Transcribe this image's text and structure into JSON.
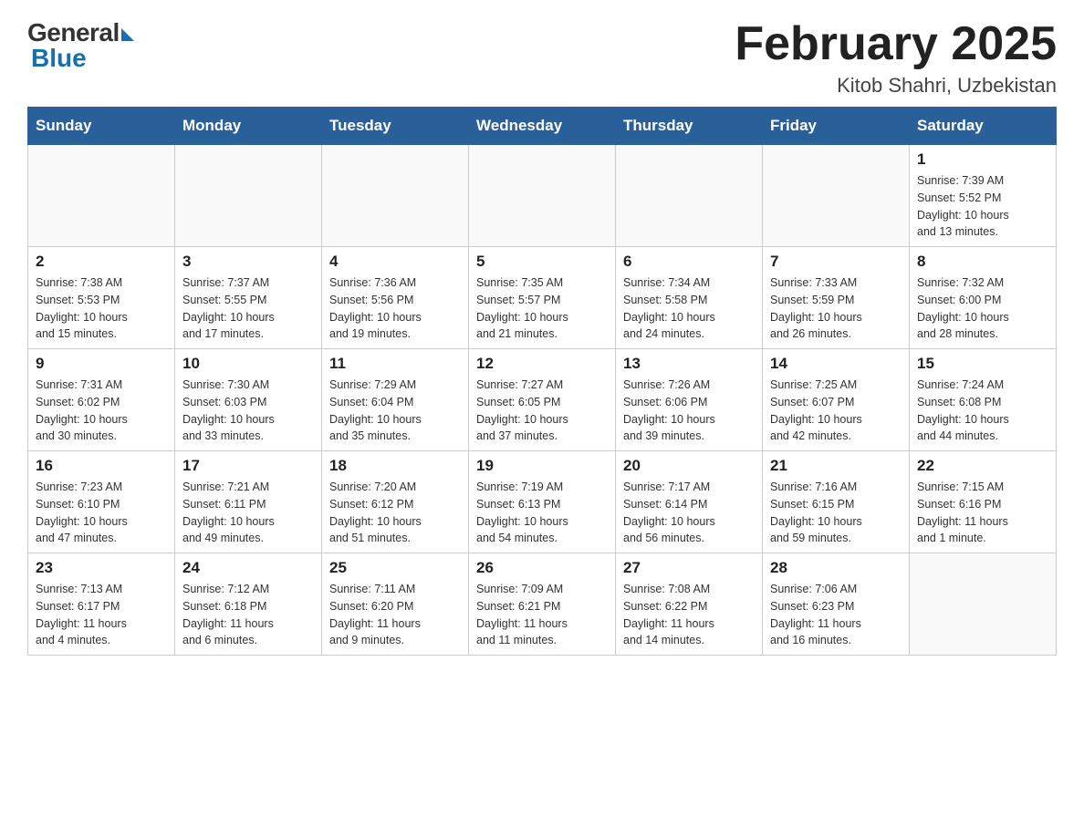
{
  "header": {
    "title": "February 2025",
    "location": "Kitob Shahri, Uzbekistan"
  },
  "logo": {
    "general": "General",
    "blue": "Blue"
  },
  "weekdays": [
    "Sunday",
    "Monday",
    "Tuesday",
    "Wednesday",
    "Thursday",
    "Friday",
    "Saturday"
  ],
  "weeks": [
    [
      {
        "day": "",
        "info": ""
      },
      {
        "day": "",
        "info": ""
      },
      {
        "day": "",
        "info": ""
      },
      {
        "day": "",
        "info": ""
      },
      {
        "day": "",
        "info": ""
      },
      {
        "day": "",
        "info": ""
      },
      {
        "day": "1",
        "info": "Sunrise: 7:39 AM\nSunset: 5:52 PM\nDaylight: 10 hours\nand 13 minutes."
      }
    ],
    [
      {
        "day": "2",
        "info": "Sunrise: 7:38 AM\nSunset: 5:53 PM\nDaylight: 10 hours\nand 15 minutes."
      },
      {
        "day": "3",
        "info": "Sunrise: 7:37 AM\nSunset: 5:55 PM\nDaylight: 10 hours\nand 17 minutes."
      },
      {
        "day": "4",
        "info": "Sunrise: 7:36 AM\nSunset: 5:56 PM\nDaylight: 10 hours\nand 19 minutes."
      },
      {
        "day": "5",
        "info": "Sunrise: 7:35 AM\nSunset: 5:57 PM\nDaylight: 10 hours\nand 21 minutes."
      },
      {
        "day": "6",
        "info": "Sunrise: 7:34 AM\nSunset: 5:58 PM\nDaylight: 10 hours\nand 24 minutes."
      },
      {
        "day": "7",
        "info": "Sunrise: 7:33 AM\nSunset: 5:59 PM\nDaylight: 10 hours\nand 26 minutes."
      },
      {
        "day": "8",
        "info": "Sunrise: 7:32 AM\nSunset: 6:00 PM\nDaylight: 10 hours\nand 28 minutes."
      }
    ],
    [
      {
        "day": "9",
        "info": "Sunrise: 7:31 AM\nSunset: 6:02 PM\nDaylight: 10 hours\nand 30 minutes."
      },
      {
        "day": "10",
        "info": "Sunrise: 7:30 AM\nSunset: 6:03 PM\nDaylight: 10 hours\nand 33 minutes."
      },
      {
        "day": "11",
        "info": "Sunrise: 7:29 AM\nSunset: 6:04 PM\nDaylight: 10 hours\nand 35 minutes."
      },
      {
        "day": "12",
        "info": "Sunrise: 7:27 AM\nSunset: 6:05 PM\nDaylight: 10 hours\nand 37 minutes."
      },
      {
        "day": "13",
        "info": "Sunrise: 7:26 AM\nSunset: 6:06 PM\nDaylight: 10 hours\nand 39 minutes."
      },
      {
        "day": "14",
        "info": "Sunrise: 7:25 AM\nSunset: 6:07 PM\nDaylight: 10 hours\nand 42 minutes."
      },
      {
        "day": "15",
        "info": "Sunrise: 7:24 AM\nSunset: 6:08 PM\nDaylight: 10 hours\nand 44 minutes."
      }
    ],
    [
      {
        "day": "16",
        "info": "Sunrise: 7:23 AM\nSunset: 6:10 PM\nDaylight: 10 hours\nand 47 minutes."
      },
      {
        "day": "17",
        "info": "Sunrise: 7:21 AM\nSunset: 6:11 PM\nDaylight: 10 hours\nand 49 minutes."
      },
      {
        "day": "18",
        "info": "Sunrise: 7:20 AM\nSunset: 6:12 PM\nDaylight: 10 hours\nand 51 minutes."
      },
      {
        "day": "19",
        "info": "Sunrise: 7:19 AM\nSunset: 6:13 PM\nDaylight: 10 hours\nand 54 minutes."
      },
      {
        "day": "20",
        "info": "Sunrise: 7:17 AM\nSunset: 6:14 PM\nDaylight: 10 hours\nand 56 minutes."
      },
      {
        "day": "21",
        "info": "Sunrise: 7:16 AM\nSunset: 6:15 PM\nDaylight: 10 hours\nand 59 minutes."
      },
      {
        "day": "22",
        "info": "Sunrise: 7:15 AM\nSunset: 6:16 PM\nDaylight: 11 hours\nand 1 minute."
      }
    ],
    [
      {
        "day": "23",
        "info": "Sunrise: 7:13 AM\nSunset: 6:17 PM\nDaylight: 11 hours\nand 4 minutes."
      },
      {
        "day": "24",
        "info": "Sunrise: 7:12 AM\nSunset: 6:18 PM\nDaylight: 11 hours\nand 6 minutes."
      },
      {
        "day": "25",
        "info": "Sunrise: 7:11 AM\nSunset: 6:20 PM\nDaylight: 11 hours\nand 9 minutes."
      },
      {
        "day": "26",
        "info": "Sunrise: 7:09 AM\nSunset: 6:21 PM\nDaylight: 11 hours\nand 11 minutes."
      },
      {
        "day": "27",
        "info": "Sunrise: 7:08 AM\nSunset: 6:22 PM\nDaylight: 11 hours\nand 14 minutes."
      },
      {
        "day": "28",
        "info": "Sunrise: 7:06 AM\nSunset: 6:23 PM\nDaylight: 11 hours\nand 16 minutes."
      },
      {
        "day": "",
        "info": ""
      }
    ]
  ]
}
